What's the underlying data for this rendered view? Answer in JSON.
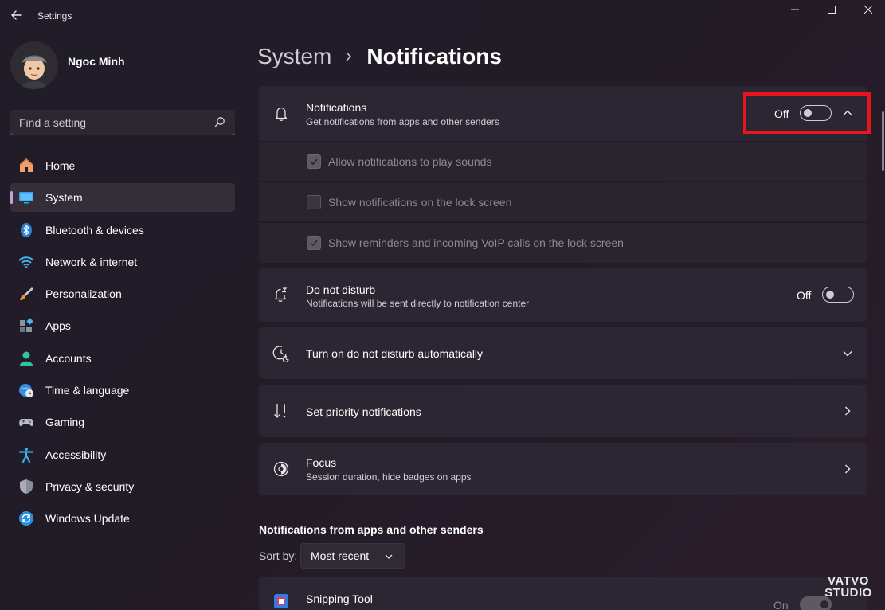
{
  "window": {
    "title": "Settings"
  },
  "profile": {
    "name": "Ngoc Minh"
  },
  "search": {
    "placeholder": "Find a setting"
  },
  "sidebar": {
    "items": [
      {
        "label": "Home",
        "icon": "home-icon"
      },
      {
        "label": "System",
        "icon": "system-icon",
        "active": true
      },
      {
        "label": "Bluetooth & devices",
        "icon": "bluetooth-icon"
      },
      {
        "label": "Network & internet",
        "icon": "wifi-icon"
      },
      {
        "label": "Personalization",
        "icon": "brush-icon"
      },
      {
        "label": "Apps",
        "icon": "apps-icon"
      },
      {
        "label": "Accounts",
        "icon": "accounts-icon"
      },
      {
        "label": "Time & language",
        "icon": "globe-clock-icon"
      },
      {
        "label": "Gaming",
        "icon": "gamepad-icon"
      },
      {
        "label": "Accessibility",
        "icon": "accessibility-icon"
      },
      {
        "label": "Privacy & security",
        "icon": "shield-icon"
      },
      {
        "label": "Windows Update",
        "icon": "update-icon"
      }
    ]
  },
  "breadcrumb": {
    "parent": "System",
    "current": "Notifications"
  },
  "notifications": {
    "title": "Notifications",
    "subtitle": "Get notifications from apps and other senders",
    "toggle_label": "Off",
    "enabled": false,
    "options": [
      {
        "label": "Allow notifications to play sounds",
        "checked": true
      },
      {
        "label": "Show notifications on the lock screen",
        "checked": false
      },
      {
        "label": "Show reminders and incoming VoIP calls on the lock screen",
        "checked": true
      }
    ]
  },
  "do_not_disturb": {
    "title": "Do not disturb",
    "subtitle": "Notifications will be sent directly to notification center",
    "toggle_label": "Off",
    "enabled": false
  },
  "dnd_auto": {
    "title": "Turn on do not disturb automatically"
  },
  "priority": {
    "title": "Set priority notifications"
  },
  "focus": {
    "title": "Focus",
    "subtitle": "Session duration, hide badges on apps"
  },
  "apps_section": {
    "heading": "Notifications from apps and other senders",
    "sort_label": "Sort by:",
    "sort_value": "Most recent",
    "first_app": {
      "name": "Snipping Tool",
      "toggle_label": "On"
    }
  },
  "watermark": {
    "line1": "VATVO",
    "line2": "STUDIO"
  },
  "colors": {
    "accent": "#c9a0dc",
    "highlight": "#e8151c",
    "background": "#201c28",
    "card": "#2b2631"
  }
}
